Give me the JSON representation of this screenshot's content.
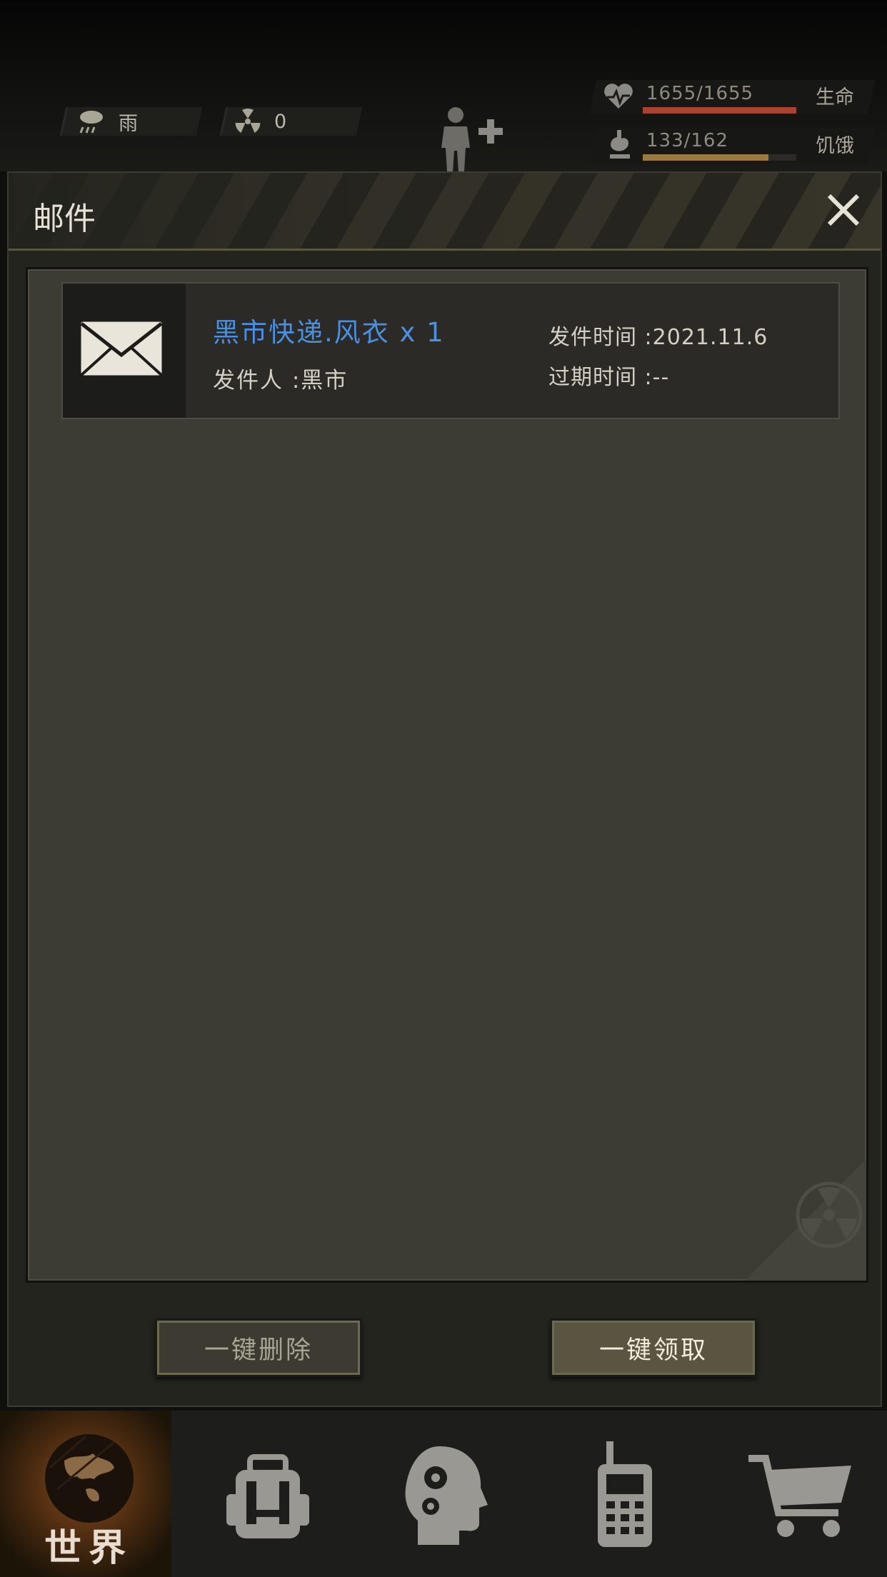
{
  "status": {
    "weather": "雨",
    "radiation": "0",
    "health": {
      "value": "1655/1655",
      "label": "生命",
      "fill": 1.0,
      "color": "#a8432f"
    },
    "hunger": {
      "value": "133/162",
      "label": "饥饿",
      "fill": 0.82,
      "color": "#9a7a3e"
    }
  },
  "panel": {
    "title": "邮件",
    "mail": {
      "title": "黑市快递.风衣 x 1",
      "sender": "发件人 :黑市",
      "sent_time": "发件时间 :2021.11.6",
      "expire_time": "过期时间 :--"
    },
    "buttons": {
      "delete_all": "一键删除",
      "claim_all": "一键领取"
    }
  },
  "nav": {
    "world_label": "世界",
    "items": [
      "world-icon",
      "backpack-icon",
      "skills-icon",
      "radio-icon",
      "cart-icon"
    ]
  }
}
